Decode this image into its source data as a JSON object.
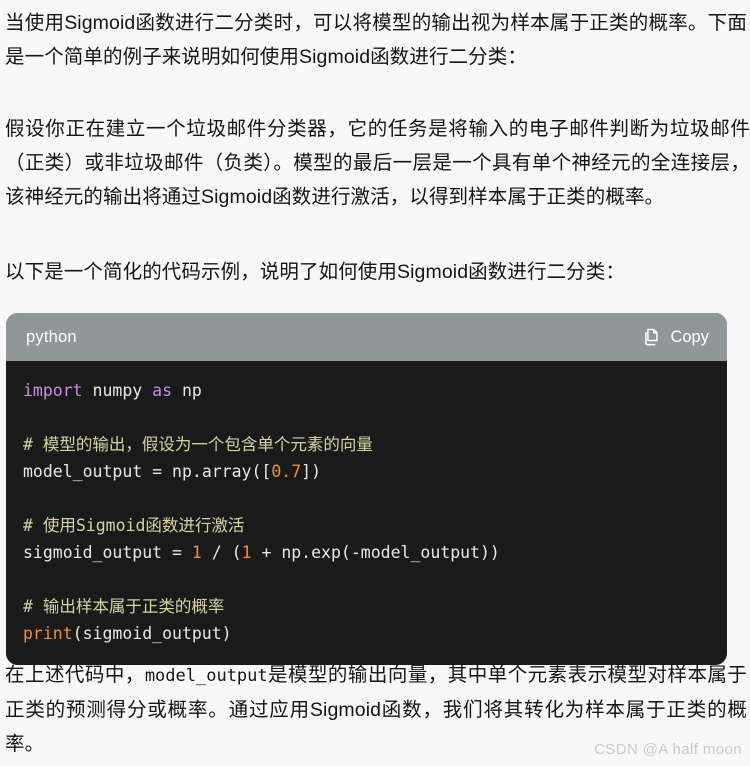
{
  "paragraphs": {
    "p1": "当使用Sigmoid函数进行二分类时，可以将模型的输出视为样本属于正类的概率。下面是一个简单的例子来说明如何使用Sigmoid函数进行二分类：",
    "p2": "假设你正在建立一个垃圾邮件分类器，它的任务是将输入的电子邮件判断为垃圾邮件（正类）或非垃圾邮件（负类）。模型的最后一层是一个具有单个神经元的全连接层，该神经元的输出将通过Sigmoid函数进行激活，以得到样本属于正类的概率。",
    "p3": "以下是一个简化的代码示例，说明了如何使用Sigmoid函数进行二分类：",
    "p4_before": "在上述代码中，",
    "p4_code": "model_output",
    "p4_after": "是模型的输出向量，其中单个元素表示模型对样本属于正类的预测得分或概率。通过应用Sigmoid函数，我们将其转化为样本属于正类的概率。"
  },
  "code_block": {
    "language": "python",
    "copy_label": "Copy",
    "copy_icon": "copy-icon",
    "header_bg": "#8f9799",
    "body_bg": "#1a1a1a",
    "lines": [
      {
        "tokens": [
          {
            "t": "import",
            "c": "kw"
          },
          {
            "t": " numpy ",
            "c": "plain"
          },
          {
            "t": "as",
            "c": "kw"
          },
          {
            "t": " np",
            "c": "plain"
          }
        ]
      },
      {
        "blank": true
      },
      {
        "tokens": [
          {
            "t": "# 模型的输出，假设为一个包含单个元素的向量",
            "c": "comment"
          }
        ]
      },
      {
        "tokens": [
          {
            "t": "model_output ",
            "c": "plain"
          },
          {
            "t": "=",
            "c": "op"
          },
          {
            "t": " np.array([",
            "c": "plain"
          },
          {
            "t": "0.7",
            "c": "num"
          },
          {
            "t": "])",
            "c": "plain"
          }
        ]
      },
      {
        "blank": true
      },
      {
        "tokens": [
          {
            "t": "# 使用Sigmoid函数进行激活",
            "c": "comment"
          }
        ]
      },
      {
        "tokens": [
          {
            "t": "sigmoid_output ",
            "c": "plain"
          },
          {
            "t": "=",
            "c": "op"
          },
          {
            "t": " ",
            "c": "plain"
          },
          {
            "t": "1",
            "c": "num"
          },
          {
            "t": " / (",
            "c": "plain"
          },
          {
            "t": "1",
            "c": "num"
          },
          {
            "t": " + np.exp(-model_output))",
            "c": "plain"
          }
        ]
      },
      {
        "blank": true
      },
      {
        "tokens": [
          {
            "t": "# 输出样本属于正类的概率",
            "c": "comment"
          }
        ]
      },
      {
        "tokens": [
          {
            "t": "print",
            "c": "fn"
          },
          {
            "t": "(sigmoid_output)",
            "c": "plain"
          }
        ]
      }
    ]
  },
  "watermark": "CSDN @A half moon"
}
